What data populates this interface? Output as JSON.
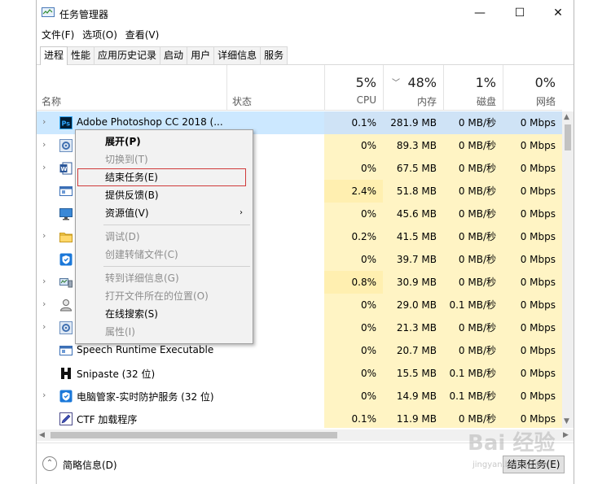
{
  "window": {
    "title": "任务管理器",
    "minimize": "—",
    "maximize": "☐",
    "close": "✕"
  },
  "menu": [
    "文件(F)",
    "选项(O)",
    "查看(V)"
  ],
  "tabs": [
    "进程",
    "性能",
    "应用历史记录",
    "启动",
    "用户",
    "详细信息",
    "服务"
  ],
  "columns": {
    "name": "名称",
    "status": "状态",
    "cpu_pct": "5%",
    "cpu": "CPU",
    "mem_pct": "48%",
    "mem": "内存",
    "disk_pct": "1%",
    "disk": "磁盘",
    "net_pct": "0%",
    "net": "网络"
  },
  "rows": [
    {
      "name": "Adobe Photoshop CC 2018 (...",
      "icon": "photoshop-icon",
      "cpu": "0.1%",
      "mem": "281.9 MB",
      "disk": "0 MB/秒",
      "net": "0 Mbps",
      "expand": "›"
    },
    {
      "name": "",
      "icon": "gear-icon",
      "cpu": "0%",
      "mem": "89.3 MB",
      "disk": "0 MB/秒",
      "net": "0 Mbps",
      "expand": "›"
    },
    {
      "name": "",
      "icon": "word-icon",
      "cpu": "0%",
      "mem": "67.5 MB",
      "disk": "0 MB/秒",
      "net": "0 Mbps",
      "expand": "›"
    },
    {
      "name": "",
      "icon": "window-icon",
      "cpu": "2.4%",
      "mem": "51.8 MB",
      "disk": "0 MB/秒",
      "net": "0 Mbps",
      "expand": ""
    },
    {
      "name": "",
      "icon": "monitor-icon",
      "cpu": "0%",
      "mem": "45.6 MB",
      "disk": "0 MB/秒",
      "net": "0 Mbps",
      "expand": ""
    },
    {
      "name": "",
      "icon": "folder-icon",
      "cpu": "0.2%",
      "mem": "41.5 MB",
      "disk": "0 MB/秒",
      "net": "0 Mbps",
      "expand": "›"
    },
    {
      "name": "",
      "icon": "shield-icon",
      "cpu": "0%",
      "mem": "39.7 MB",
      "disk": "0 MB/秒",
      "net": "0 Mbps",
      "expand": ""
    },
    {
      "name": "",
      "icon": "network-icon",
      "cpu": "0.8%",
      "mem": "30.9 MB",
      "disk": "0 MB/秒",
      "net": "0 Mbps",
      "expand": "›"
    },
    {
      "name": "",
      "icon": "user-icon",
      "cpu": "0%",
      "mem": "29.0 MB",
      "disk": "0.1 MB/秒",
      "net": "0 Mbps",
      "expand": "›"
    },
    {
      "name": "",
      "icon": "gear-icon",
      "cpu": "0%",
      "mem": "21.3 MB",
      "disk": "0 MB/秒",
      "net": "0 Mbps",
      "expand": "›"
    },
    {
      "name": "Speech Runtime Executable",
      "icon": "window-icon",
      "cpu": "0%",
      "mem": "20.7 MB",
      "disk": "0 MB/秒",
      "net": "0 Mbps",
      "expand": ""
    },
    {
      "name": "Snipaste (32 位)",
      "icon": "snipaste-icon",
      "cpu": "0%",
      "mem": "15.5 MB",
      "disk": "0.1 MB/秒",
      "net": "0 Mbps",
      "expand": ""
    },
    {
      "name": "电脑管家-实时防护服务 (32 位)",
      "icon": "shield-icon",
      "cpu": "0%",
      "mem": "14.9 MB",
      "disk": "0.1 MB/秒",
      "net": "0 Mbps",
      "expand": "›"
    },
    {
      "name": "CTF 加载程序",
      "icon": "pen-icon",
      "cpu": "0.1%",
      "mem": "11.9 MB",
      "disk": "0 MB/秒",
      "net": "0 Mbps",
      "expand": ""
    }
  ],
  "context_menu": [
    {
      "label": "展开(P)",
      "state": "bold"
    },
    {
      "label": "切换到(T)",
      "state": "disabled"
    },
    {
      "label": "结束任务(E)",
      "state": "boxed"
    },
    {
      "label": "提供反馈(B)",
      "state": "normal"
    },
    {
      "label": "资源值(V)",
      "state": "submenu",
      "arrow": "›"
    },
    {
      "label": "调试(D)",
      "state": "disabled"
    },
    {
      "label": "创建转储文件(C)",
      "state": "disabled"
    },
    {
      "label": "转到详细信息(G)",
      "state": "disabled"
    },
    {
      "label": "打开文件所在的位置(O)",
      "state": "disabled"
    },
    {
      "label": "在线搜索(S)",
      "state": "normal"
    },
    {
      "label": "属性(I)",
      "state": "disabled"
    }
  ],
  "footer": {
    "fewer_details_icon": "⌃",
    "fewer_details": "简略信息(D)",
    "end_task": "结束任务(E)"
  },
  "scroll": {
    "up": "▲",
    "down": "▼",
    "left": "◀",
    "right": "▶"
  },
  "sort_indicator": "﹀",
  "watermark": {
    "main": "Bai 经验",
    "sub": "jingyan.baidu.com"
  }
}
